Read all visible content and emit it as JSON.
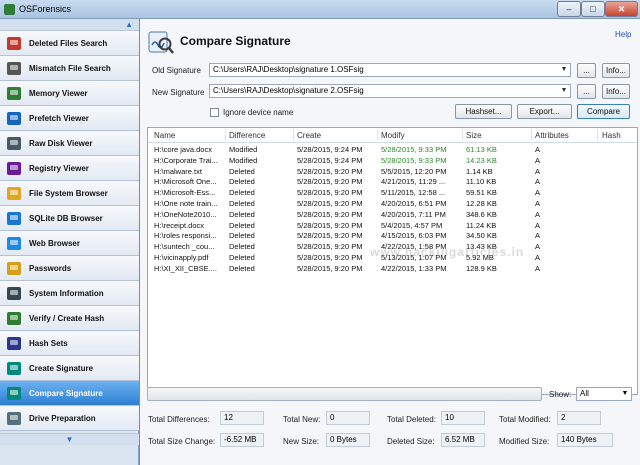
{
  "window": {
    "title": "OSForensics",
    "min": "–",
    "max": "□",
    "close": "✕"
  },
  "sidebar": {
    "scroll_up": "▲",
    "scroll_down": "▼",
    "items": [
      {
        "label": "Deleted Files Search",
        "icon": "deleted-files-icon",
        "color": "#c0392b"
      },
      {
        "label": "Mismatch File Search",
        "icon": "abc-icon",
        "color": "#555555"
      },
      {
        "label": "Memory Viewer",
        "icon": "memory-chip-icon",
        "color": "#2e7d32"
      },
      {
        "label": "Prefetch Viewer",
        "icon": "prefetch-icon",
        "color": "#1565c0"
      },
      {
        "label": "Raw Disk Viewer",
        "icon": "disk-icon",
        "color": "#455a64"
      },
      {
        "label": "Registry Viewer",
        "icon": "registry-icon",
        "color": "#6a1b9a"
      },
      {
        "label": "File System Browser",
        "icon": "folder-icon",
        "color": "#e0a521"
      },
      {
        "label": "SQLite DB Browser",
        "icon": "database-icon",
        "color": "#1976d2"
      },
      {
        "label": "Web Browser",
        "icon": "globe-icon",
        "color": "#1e88e5"
      },
      {
        "label": "Passwords",
        "icon": "key-icon",
        "color": "#d4a017"
      },
      {
        "label": "System Information",
        "icon": "computer-icon",
        "color": "#37474f"
      },
      {
        "label": "Verify / Create Hash",
        "icon": "hash-icon",
        "color": "#2e7d32"
      },
      {
        "label": "Hash Sets",
        "icon": "hash-sets-icon",
        "color": "#283593"
      },
      {
        "label": "Create Signature",
        "icon": "create-signature-icon",
        "color": "#00897b"
      },
      {
        "label": "Compare Signature",
        "icon": "compare-signature-icon",
        "color": "#00897b",
        "active": true
      },
      {
        "label": "Drive Preparation",
        "icon": "drive-icon",
        "color": "#546e7a"
      }
    ]
  },
  "header": {
    "title": "Compare Signature",
    "help": "Help"
  },
  "form": {
    "old_label": "Old Signature",
    "old_value": "C:\\Users\\RAJ\\Desktop\\signature 1.OSFsig",
    "new_label": "New Signature",
    "new_value": "C:\\Users\\RAJ\\Desktop\\signature 2.OSFsig",
    "browse": "...",
    "info": "Info...",
    "ignore_label": "Ignore device name",
    "hashset": "Hashset...",
    "export": "Export...",
    "compare": "Compare"
  },
  "table": {
    "columns": [
      "Name",
      "Difference",
      "Create",
      "Modify",
      "Size",
      "Attributes",
      "Hash"
    ],
    "rows": [
      [
        "H:\\core java.docx",
        "Modified",
        "5/28/2015, 9:24 PM",
        "5/28/2015, 9:33 PM",
        "61.13 KB",
        "A",
        true
      ],
      [
        "H:\\Corporate Trai...",
        "Modified",
        "5/28/2015, 9:24 PM",
        "5/28/2015, 9:33 PM",
        "14.23 KB",
        "A",
        true
      ],
      [
        "H:\\malware.txt",
        "Deleted",
        "5/28/2015, 9:20 PM",
        "5/5/2015, 12:20 PM",
        "1.14 KB",
        "A",
        false
      ],
      [
        "H:\\Microsoft One...",
        "Deleted",
        "5/28/2015, 9:20 PM",
        "4/21/2015, 11:29 ...",
        "11.10 KB",
        "A",
        false
      ],
      [
        "H:\\Microsoft-Ess...",
        "Deleted",
        "5/28/2015, 9:20 PM",
        "5/11/2015, 12:58 ...",
        "59.51 KB",
        "A",
        false
      ],
      [
        "H:\\One note train...",
        "Deleted",
        "5/28/2015, 9:20 PM",
        "4/20/2015, 6:51 PM",
        "12.28 KB",
        "A",
        false
      ],
      [
        "H:\\OneNote2010...",
        "Deleted",
        "5/28/2015, 9:20 PM",
        "4/20/2015, 7:11 PM",
        "348.6 KB",
        "A",
        false
      ],
      [
        "H:\\receipt.docx",
        "Deleted",
        "5/28/2015, 9:20 PM",
        "5/4/2015, 4:57 PM",
        "11.24 KB",
        "A",
        false
      ],
      [
        "H:\\roles responsi...",
        "Deleted",
        "5/28/2015, 9:20 PM",
        "4/15/2015, 6:03 PM",
        "34.50 KB",
        "A",
        false
      ],
      [
        "H:\\suntech _cou...",
        "Deleted",
        "5/28/2015, 9:20 PM",
        "4/22/2015, 1:58 PM",
        "13.43 KB",
        "A",
        false
      ],
      [
        "H:\\vicinapply.pdf",
        "Deleted",
        "5/28/2015, 9:20 PM",
        "5/13/2015, 1:07 PM",
        "5.92 MB",
        "A",
        false
      ],
      [
        "H:\\XI_XII_CBSE....",
        "Deleted",
        "5/28/2015, 9:20 PM",
        "4/22/2015, 1:33 PM",
        "128.9 KB",
        "A",
        false
      ]
    ]
  },
  "watermark": "www.hackingarticles.in",
  "progress": {
    "fraction": 0
  },
  "show": {
    "label": "Show:",
    "value": "All"
  },
  "stats": {
    "total_diff_label": "Total Differences:",
    "total_diff": "12",
    "total_new_label": "Total New:",
    "total_new": "0",
    "total_deleted_label": "Total Deleted:",
    "total_deleted": "10",
    "total_modified_label": "Total Modified:",
    "total_modified": "2",
    "size_change_label": "Total Size Change:",
    "size_change": "-6.52 MB",
    "new_size_label": "New Size:",
    "new_size": "0 Bytes",
    "deleted_size_label": "Deleted Size:",
    "deleted_size": "6.52 MB",
    "modified_size_label": "Modified Size:",
    "modified_size": "140 Bytes"
  }
}
